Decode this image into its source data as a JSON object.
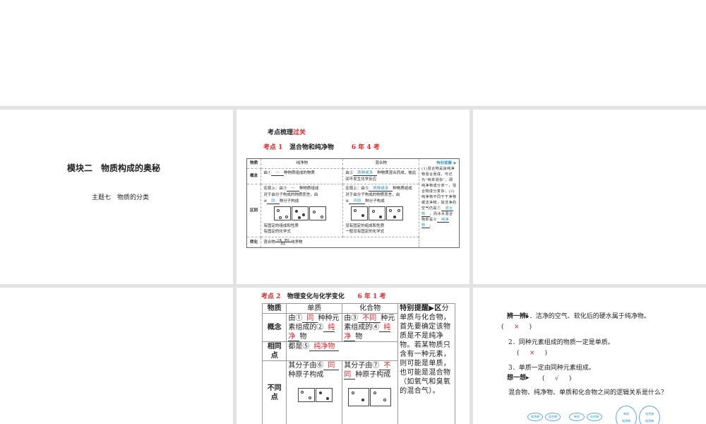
{
  "slide1": {
    "title": "模块二　物质构成的奥秘",
    "subtitle": "主题七　物质的分类"
  },
  "slide2": {
    "section": "考点梳理",
    "section_red": "过关",
    "point_label": "考点 1",
    "point_title": "混合物和纯净物",
    "freq": "6 年 4 考",
    "headers": [
      "物质",
      "纯净物",
      "混合物"
    ],
    "row_concept": {
      "label": "概念",
      "pure_pre": "由①",
      "pure_blank": "一",
      "pure_post": "种物质组成的物质",
      "mix_pre": "由②",
      "mix_blank": "两种或多",
      "mix_post": "种物质混合而成，彼此间不发生化学反应"
    },
    "row_diff": {
      "label": "区别",
      "pure_l1_pre": "宏观上：由③",
      "pure_l1_blank": "一",
      "pure_l1_post": "种物质组成",
      "pure_l2": "对于由分子构成的物质而言，由",
      "pure_l3_pre": "④",
      "pure_l3_blank": "同",
      "pure_l3_post": "种分子构成",
      "pure_l4": "有固定的组成和性质",
      "pure_l5": "有固定的化学式",
      "mix_l1_pre": "宏观上：由⑤",
      "mix_l1_blank": "两种或多",
      "mix_l1_post": "种物质组成",
      "mix_l2": "对于由分子构成的物质而言，由",
      "mix_l3_pre": "⑥",
      "mix_l3_blank": "不同",
      "mix_l3_post": "种分子构成",
      "mix_l4": "没有固定的组成和性质",
      "mix_l5": "一般没有固定的化学式"
    },
    "row_convert": {
      "label": "转化",
      "left": "混合物",
      "arrow_top": "分离、提纯",
      "arrow_bottom": "混合",
      "right": "纯净物"
    },
    "tip": {
      "title": "特别提醒 ▶",
      "text": "(1)混合物是由纯净物混合而成，可记为“纯单混杂”，即纯净物成分单一，混合物成分复杂。(2)纯净物不同于干净物或洁净物，如洁净的空气仍是",
      "blank7_pre": "⑦",
      "blank7": "混合物",
      "text2": "，而冰水混合物却是",
      "blank8_pre": "⑧",
      "blank8": "纯净物",
      "end": "。"
    }
  },
  "slide5": {
    "point_label": "考点 2",
    "point_title": "物理变化与化学变化",
    "freq": "6 年 1 考",
    "headers": [
      "物质",
      "单质",
      "化合物"
    ],
    "tip_title": "特别提醒▶区",
    "tip_text": "分单质与化合物，首先要确定该物质是不是纯净物。若某物质只含有一种元素，则可能是单质，也可能是混合物（如氧气和臭氧的混合气）。",
    "concept_label": "概念",
    "single_pre": "由①",
    "single_b1": "同",
    "single_mid": "种元素组成的②",
    "single_b2": "纯净",
    "single_post": "物",
    "comp_pre": "由③",
    "comp_b1": "不同",
    "comp_mid": "种元素组成的",
    "comp_b2_pre": "④",
    "comp_b2": "纯净",
    "comp_post": "物",
    "same_label": "相同点",
    "same_pre": "都是⑤",
    "same_blank": "纯净物",
    "diff_label": "不同点",
    "diff_single_pre": "其分子由⑥",
    "diff_single_blank": "同",
    "diff_single_post": "种原子构成",
    "diff_comp_pre": "其分子由⑦",
    "diff_comp_blank": "不同",
    "diff_comp_post": "种原子构成"
  },
  "slide6": {
    "judge_label": "辨一辨▸",
    "q1": "1．洁净的空气、软化后的硬水属于纯净物。",
    "a1": "×",
    "q2": "2．同种元素组成的物质一定是单质。",
    "a2": "×",
    "q3": "3．单质一定由同种元素组成。",
    "a3": "√",
    "think_label": "想一想▸",
    "think_q": "混合物、纯净物、单质和化合物之间的逻辑关系是什么？",
    "diagram": [
      "纯净物",
      "混合物",
      "单质",
      "化合物",
      "单质",
      "纯净物",
      "化合物",
      "纯净物"
    ]
  }
}
